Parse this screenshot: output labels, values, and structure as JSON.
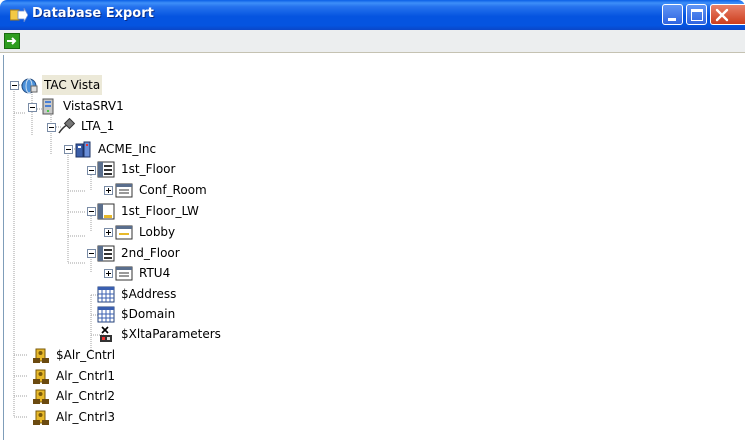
{
  "window": {
    "title": "Database Export"
  },
  "toolbar": {
    "export_icon": "green-arrow-right-icon"
  },
  "tree": {
    "root": "TAC Vista",
    "server": "VistaSRV1",
    "lta": "LTA_1",
    "org": "ACME_Inc",
    "floor1": "1st_Floor",
    "conf_room": "Conf_Room",
    "floor1_lw": "1st_Floor_LW",
    "lobby": "Lobby",
    "floor2": "2nd_Floor",
    "rtu4": "RTU4",
    "address": "$Address",
    "domain": "$Domain",
    "xlta": "$XltaParameters",
    "alr0": "$Alr_Cntrl",
    "alr1": "Alr_Cntrl1",
    "alr2": "Alr_Cntrl2",
    "alr3": "Alr_Cntrl3"
  },
  "colors": {
    "titlebar": "#0554e0",
    "close_button": "#cc3d1d",
    "selection": "#ece9d8"
  }
}
